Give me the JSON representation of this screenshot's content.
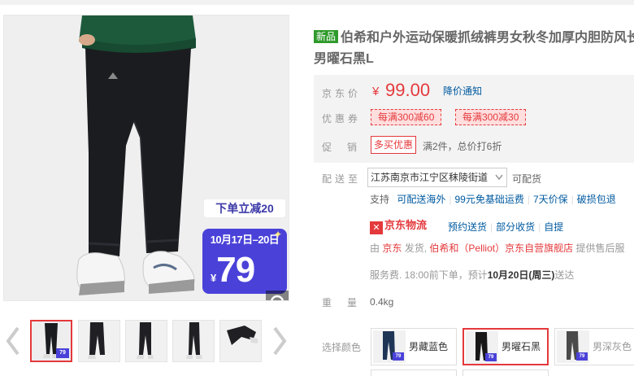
{
  "gallery": {
    "main_promo_tag": "下单立减20",
    "main_promo_dates": "10月17日–20日",
    "main_promo_currency": "¥",
    "main_promo_price": "79",
    "thumb_promo_price": "79",
    "zoom_icon": "magnifier-icon",
    "prev_icon": "chevron-left-icon",
    "next_icon": "chevron-right-icon",
    "thumbnail_count": 5,
    "active_thumbnail": 1
  },
  "product": {
    "new_badge": "新品",
    "title_line1": "伯希和户外运动保暖抓绒裤男女秋冬加厚内胆防风长",
    "title_line2": "男曜石黑L"
  },
  "price": {
    "label": "京东价",
    "currency": "¥",
    "value": "99.00",
    "alert_link": "降价通知"
  },
  "coupons": {
    "label": "优惠券",
    "items": [
      "每满300减60",
      "每满300减30"
    ]
  },
  "promotion": {
    "label": "促销",
    "badge": "多买优惠",
    "text": "满2件，总价打6折"
  },
  "delivery": {
    "label": "配送至",
    "address": "江苏南京市江宁区秣陵街道",
    "availability": "可配货",
    "support_label": "支持",
    "services": [
      "可配送海外",
      "99元免基础运费",
      "7天价保",
      "破损包退"
    ],
    "logistics_name": "京东物流",
    "logistics_options": [
      "预约送货",
      "部分收货",
      "自提"
    ],
    "seller_prefix": "由",
    "seller_jd": "京东",
    "seller_mid": "发货,",
    "seller_store": "伯希和（Pelliot）京东自营旗舰店",
    "seller_suffix": "提供售后服",
    "service_fee": "服务费. 18:00前下单，预计",
    "eta": "10月20日(周三)",
    "eta_suffix": "送达"
  },
  "weight": {
    "label": "重量",
    "value": "0.4kg"
  },
  "colors": {
    "label": "选择颜色",
    "options": [
      {
        "name": "男藏蓝色",
        "swatch": "#1f3556",
        "selected": false
      },
      {
        "name": "男曜石黑",
        "swatch": "#181818",
        "selected": true
      },
      {
        "name": "男深灰色",
        "swatch": "#4a4a4a",
        "selected": false
      }
    ]
  },
  "palette": {
    "accent_red": "#e4393c",
    "link_blue": "#005aa0",
    "promo_purple": "#4a42d8",
    "new_green": "#2f9a2c"
  }
}
